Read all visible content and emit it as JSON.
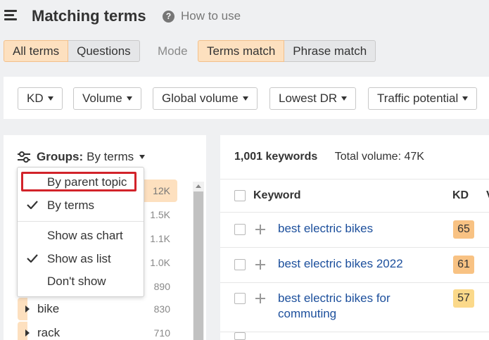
{
  "header": {
    "title": "Matching terms",
    "help_label": "How to use",
    "help_icon": "question-circle-icon"
  },
  "tabs": {
    "scope": [
      {
        "label": "All terms",
        "active": true
      },
      {
        "label": "Questions",
        "active": false
      }
    ],
    "mode_label": "Mode",
    "mode": [
      {
        "label": "Terms match",
        "active": true
      },
      {
        "label": "Phrase match",
        "active": false
      }
    ]
  },
  "filters": [
    "KD",
    "Volume",
    "Global volume",
    "Lowest DR",
    "Traffic potential"
  ],
  "groups": {
    "label": "Groups:",
    "value": "By terms",
    "counts": [
      "12K",
      "1.5K",
      "1.1K",
      "1.0K",
      "890"
    ],
    "rows": [
      {
        "name": "bike",
        "count": "830"
      },
      {
        "name": "rack",
        "count": "710"
      }
    ],
    "dropdown": [
      {
        "label": "By parent topic",
        "checked": false,
        "highlighted": true
      },
      {
        "label": "By terms",
        "checked": true,
        "highlighted": false
      },
      {
        "label": "Show as chart",
        "checked": false,
        "highlighted": false
      },
      {
        "label": "Show as list",
        "checked": true,
        "highlighted": false
      },
      {
        "label": "Don't show",
        "checked": false,
        "highlighted": false
      }
    ]
  },
  "results": {
    "count_label": "1,001 keywords",
    "total_volume": "Total volume: 47K",
    "columns": {
      "keyword": "Keyword",
      "kd": "KD",
      "more": "V"
    },
    "rows": [
      {
        "keyword": "best electric bikes",
        "kd": "65",
        "kd_color": "#f8c283"
      },
      {
        "keyword": "best electric bikes 2022",
        "kd": "61",
        "kd_color": "#f8c283"
      },
      {
        "keyword": "best electric bikes for commuting",
        "kd": "57",
        "kd_color": "#fbd98a"
      }
    ]
  },
  "colors": {
    "accent_active": "#fde0bf",
    "link": "#1c4f9c",
    "highlight_border": "#d2232a"
  }
}
